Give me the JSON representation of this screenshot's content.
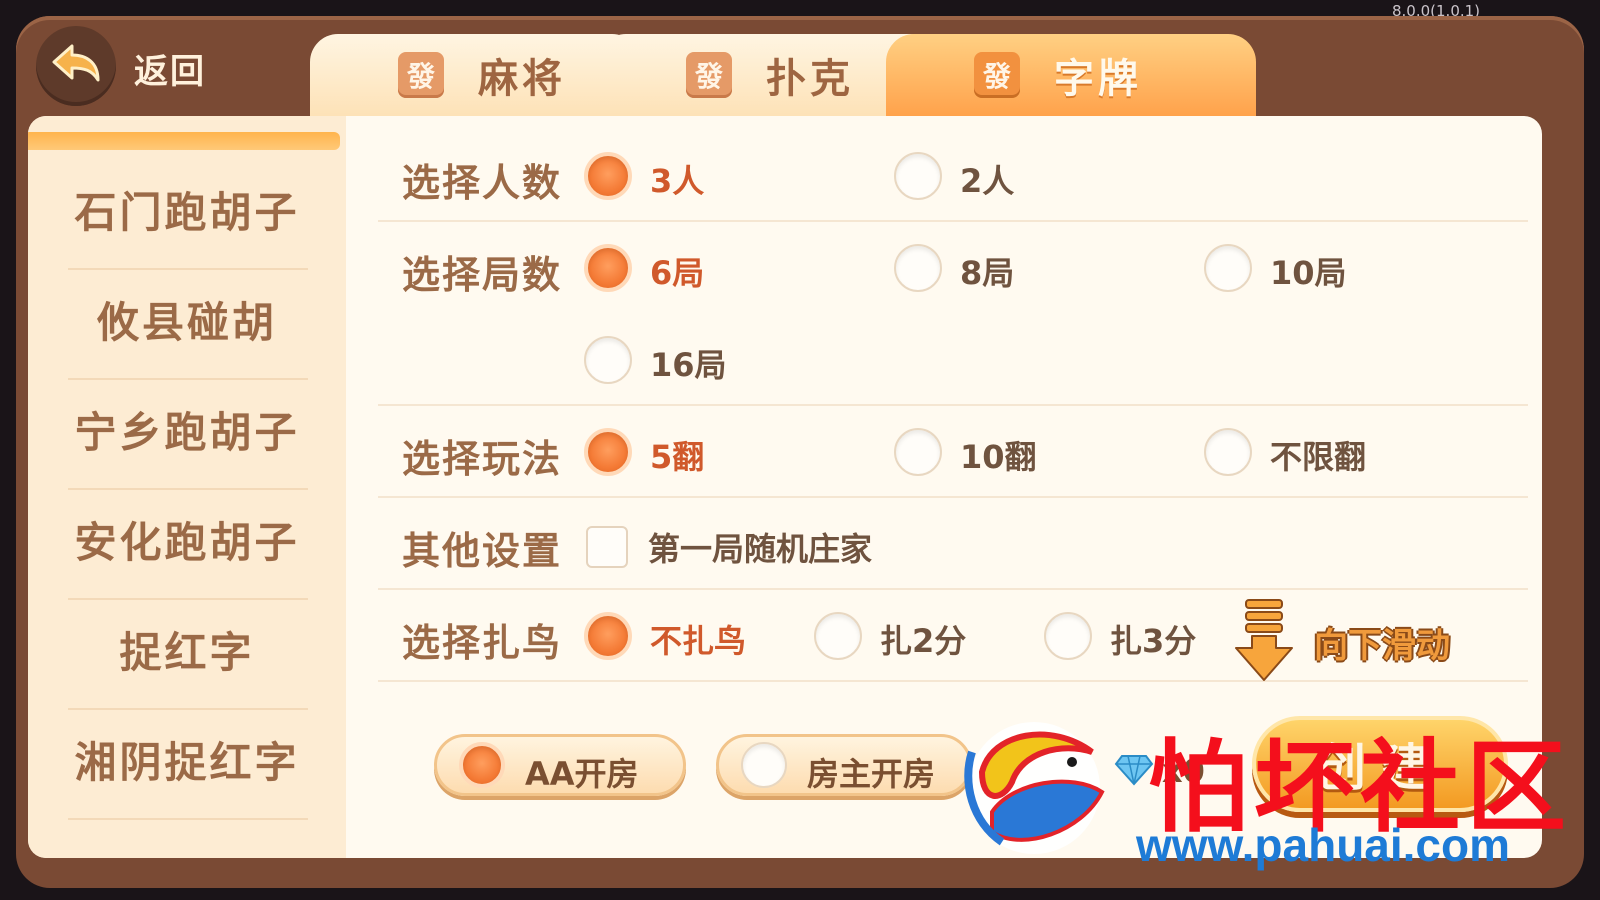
{
  "version": "8.0.0(1.0.1)",
  "header": {
    "back_label": "返回",
    "tabs": [
      {
        "label": "麻将",
        "icon_char": "發",
        "icon": "fa-tile-icon",
        "active": false
      },
      {
        "label": "扑克",
        "icon_char": "發",
        "icon": "fa-tile-icon",
        "active": false
      },
      {
        "label": "字牌",
        "icon_char": "發",
        "icon": "fa-tile-icon",
        "active": true
      }
    ]
  },
  "sidebar": {
    "items": [
      "石门跑胡子",
      "攸县碰胡",
      "宁乡跑胡子",
      "安化跑胡子",
      "捉红字",
      "湘阴捉红字"
    ],
    "selected_index": 0
  },
  "settings": {
    "players": {
      "label": "选择人数",
      "options": [
        "3人",
        "2人"
      ],
      "selected": 0
    },
    "rounds": {
      "label": "选择局数",
      "options": [
        "6局",
        "8局",
        "10局",
        "16局"
      ],
      "selected": 0
    },
    "mode": {
      "label": "选择玩法",
      "options": [
        "5翻",
        "10翻",
        "不限翻"
      ],
      "selected": 0
    },
    "other": {
      "label": "其他设置",
      "checkbox_label": "第一局随机庄家",
      "checked": false
    },
    "bird": {
      "label": "选择扎鸟",
      "options": [
        "不扎鸟",
        "扎2分",
        "扎3分"
      ],
      "selected": 0
    },
    "scroll_hint": "向下滑动"
  },
  "footer": {
    "room_options": [
      "AA开房",
      "房主开房"
    ],
    "room_selected": 0,
    "cost": "x0",
    "create_label": "创建"
  },
  "watermark": {
    "title": "怕坏社区",
    "url": "www.pahuai.com"
  },
  "colors": {
    "accent": "#f47a35",
    "panel": "#7a4a34",
    "content_bg": "#fffaf0",
    "sidebar_bg": "#fdecd3",
    "watermark_red": "#f40f1c",
    "watermark_blue": "#1e7bd6"
  }
}
